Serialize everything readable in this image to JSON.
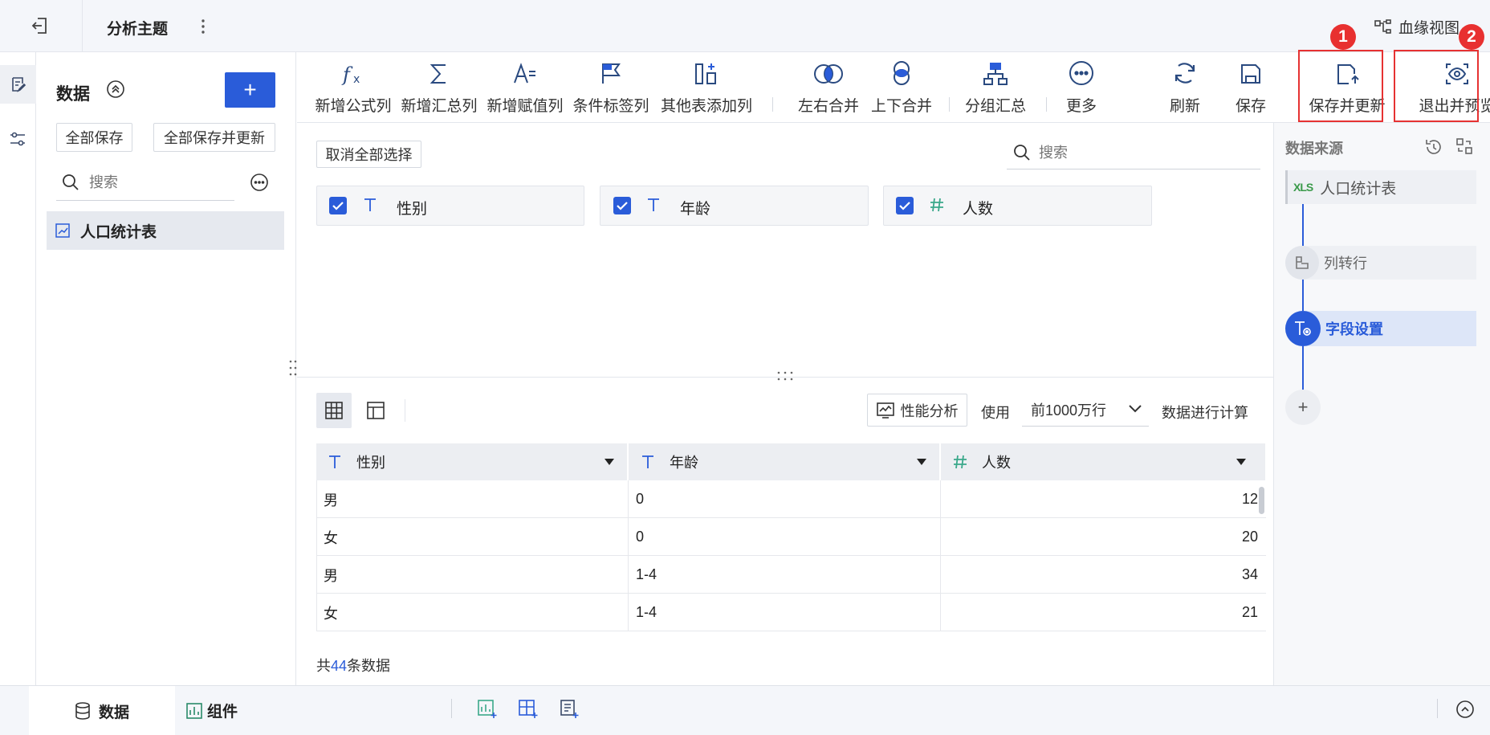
{
  "topbar": {
    "title": "分析主题",
    "lineage_label": "血缘视图"
  },
  "panel": {
    "title": "数据",
    "add_label": "+",
    "save_all": "全部保存",
    "save_all_update": "全部保存并更新",
    "search_placeholder": "搜索",
    "table_item": "人口统计表"
  },
  "toolbar": {
    "formula": "新增公式列",
    "summary": "新增汇总列",
    "assign": "新增赋值列",
    "condition": "条件标签列",
    "other": "其他表添加列",
    "lr_merge": "左右合并",
    "ud_merge": "上下合并",
    "group": "分组汇总",
    "more": "更多",
    "refresh": "刷新",
    "save": "保存",
    "save_update": "保存并更新",
    "exit_preview": "退出并预览"
  },
  "badges": {
    "b1": "1",
    "b2": "2"
  },
  "main": {
    "deselect_all": "取消全部选择",
    "search_placeholder": "搜索",
    "fields": [
      {
        "type": "T",
        "name": "性别"
      },
      {
        "type": "T",
        "name": "年龄"
      },
      {
        "type": "#",
        "name": "人数"
      }
    ],
    "perf_label": "性能分析",
    "use_label": "使用",
    "rows_select": "前1000万行",
    "calc_label": "数据进行计算",
    "columns": [
      {
        "type": "T",
        "name": "性别"
      },
      {
        "type": "T",
        "name": "年龄"
      },
      {
        "type": "#",
        "name": "人数"
      }
    ],
    "rows": [
      [
        "男",
        "0",
        "12"
      ],
      [
        "女",
        "0",
        "20"
      ],
      [
        "男",
        "1-4",
        "34"
      ],
      [
        "女",
        "1-4",
        "21"
      ]
    ],
    "total_prefix": "共",
    "total_count": "44",
    "total_suffix": "条数据"
  },
  "right": {
    "title": "数据来源",
    "source_icon": "XLS",
    "source": "人口统计表",
    "step1": "列转行",
    "step2": "字段设置",
    "add": "+"
  },
  "bottom": {
    "tab_data": "数据",
    "tab_comp": "组件"
  },
  "colors": {
    "accent": "#2a5cd9",
    "highlight": "#e63232",
    "number_type": "#3aa88a"
  }
}
